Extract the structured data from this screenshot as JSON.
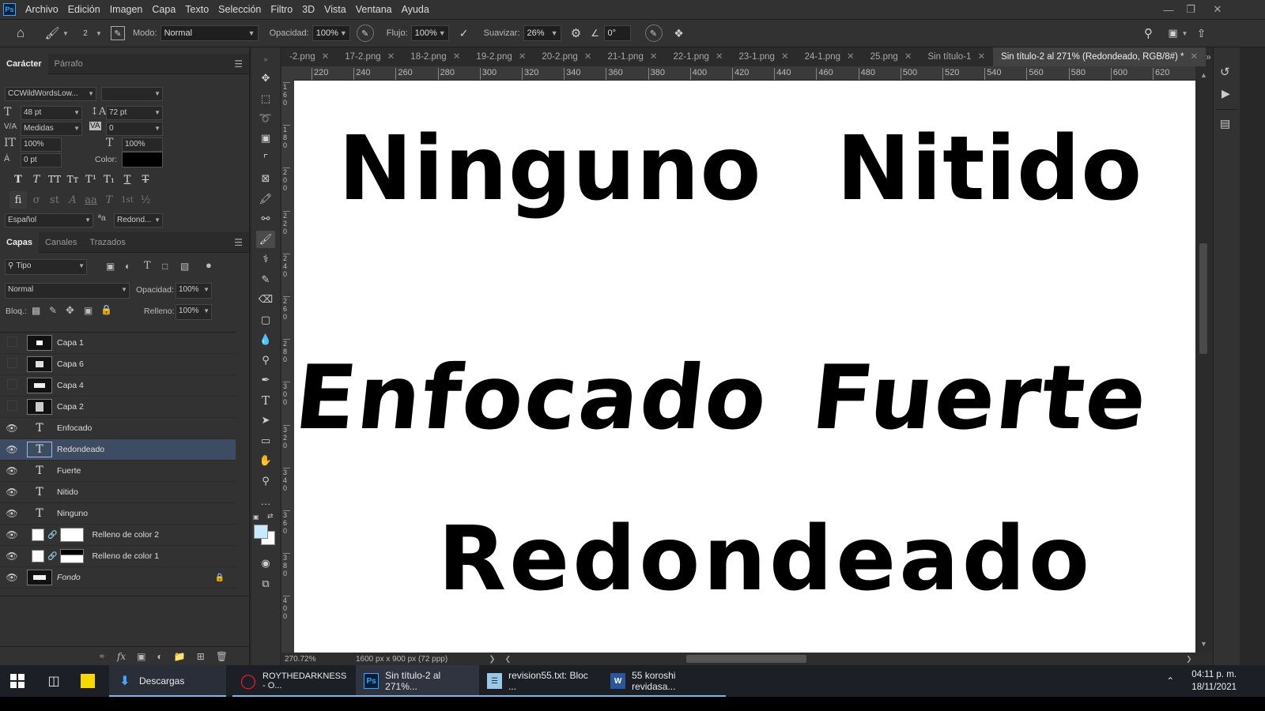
{
  "menu": [
    "Archivo",
    "Edición",
    "Imagen",
    "Capa",
    "Texto",
    "Selección",
    "Filtro",
    "3D",
    "Vista",
    "Ventana",
    "Ayuda"
  ],
  "options": {
    "brush_size": "2",
    "mode_label": "Modo:",
    "mode_value": "Normal",
    "opacity_label": "Opacidad:",
    "opacity_value": "100%",
    "flow_label": "Flujo:",
    "flow_value": "100%",
    "smoothing_label": "Suavizar:",
    "smoothing_value": "26%",
    "angle_value": "0°"
  },
  "character_panel": {
    "tabs": [
      "Carácter",
      "Párrafo"
    ],
    "font_family": "CCWildWordsLow...",
    "font_style": " ",
    "font_size": "48 pt",
    "leading": "72 pt",
    "kerning": "Medidas",
    "tracking": "0",
    "vertical_scale": "100%",
    "horizontal_scale": "100%",
    "baseline_shift": "0 pt",
    "color_label": "Color:",
    "color_value": "#000000",
    "language": "Español",
    "antialias_label": "ªa",
    "antialias": "Redond..."
  },
  "layers_panel": {
    "tabs": [
      "Capas",
      "Canales",
      "Trazados"
    ],
    "filter_kind": "Tipo",
    "blend_mode": "Normal",
    "opacity_label": "Opacidad:",
    "opacity_value": "100%",
    "lock_label": "Bloq.:",
    "fill_label": "Relleno:",
    "fill_value": "100%",
    "layers": [
      {
        "name": "Capa 1",
        "visible": false,
        "kind": "pixel"
      },
      {
        "name": "Capa 6",
        "visible": false,
        "kind": "pixel"
      },
      {
        "name": "Capa 4",
        "visible": false,
        "kind": "pixel"
      },
      {
        "name": "Capa 2",
        "visible": false,
        "kind": "pixel"
      },
      {
        "name": "Enfocado",
        "visible": true,
        "kind": "text"
      },
      {
        "name": "Redondeado",
        "visible": true,
        "kind": "text",
        "selected": true
      },
      {
        "name": "Fuerte",
        "visible": true,
        "kind": "text"
      },
      {
        "name": "Nitido",
        "visible": true,
        "kind": "text"
      },
      {
        "name": "Ninguno",
        "visible": true,
        "kind": "text"
      },
      {
        "name": "Relleno de color 2",
        "visible": true,
        "kind": "fill"
      },
      {
        "name": "Relleno de color 1",
        "visible": true,
        "kind": "fill"
      },
      {
        "name": "Fondo",
        "visible": true,
        "kind": "background",
        "locked": true
      }
    ]
  },
  "doc_tabs": [
    {
      "label": "-2.png"
    },
    {
      "label": "17-2.png"
    },
    {
      "label": "18-2.png"
    },
    {
      "label": "19-2.png"
    },
    {
      "label": "20-2.png"
    },
    {
      "label": "21-1.png"
    },
    {
      "label": "22-1.png"
    },
    {
      "label": "23-1.png"
    },
    {
      "label": "24-1.png"
    },
    {
      "label": "25.png"
    },
    {
      "label": "Sin título-1"
    },
    {
      "label": "Sin título-2 al 271% (Redondeado, RGB/8#) *",
      "active": true
    }
  ],
  "ruler_h": [
    "220",
    "240",
    "260",
    "280",
    "300",
    "320",
    "340",
    "360",
    "380",
    "400",
    "420",
    "440",
    "460",
    "480",
    "500",
    "520",
    "540",
    "560",
    "580",
    "600",
    "620"
  ],
  "ruler_v": [
    "160",
    "180",
    "200",
    "220",
    "240",
    "260",
    "280",
    "300",
    "320",
    "340",
    "360",
    "380",
    "400"
  ],
  "canvas_text": {
    "ninguno": "Ninguno",
    "nitido": "Nitido",
    "enfocado": "Enfocado",
    "fuerte": "Fuerte",
    "redondeado": "Redondeado"
  },
  "status": {
    "zoom": "270.72%",
    "doc_size": "1600 px x 900 px (72 ppp)"
  },
  "taskbar": {
    "apps": [
      {
        "label": "Descargas",
        "icon": "download-folder-icon"
      },
      {
        "label": "ROYTHEDARKNESS - O...",
        "icon": "opera-icon"
      },
      {
        "label": "Sin título-2 al 271%...",
        "icon": "photoshop-icon",
        "active": true
      },
      {
        "label": "revision55.txt: Bloc ...",
        "icon": "notepad-icon"
      },
      {
        "label": "55 koroshi revidasa...",
        "icon": "word-icon"
      }
    ],
    "time": "04:11 p. m.",
    "date": "18/11/2021"
  },
  "colors": {
    "accent": "#31a8ff",
    "selected_layer": "#3d4c63",
    "foreground_swatch": "#c6eaff",
    "background_swatch": "#ffffff"
  }
}
